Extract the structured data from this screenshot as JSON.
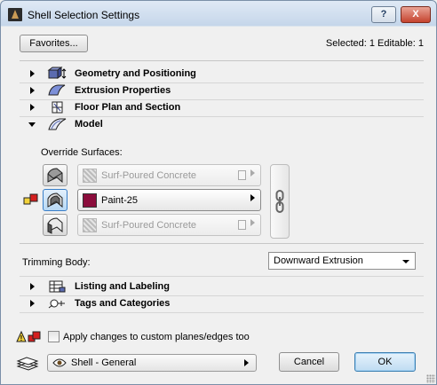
{
  "window": {
    "title": "Shell Selection Settings",
    "help_label": "?",
    "close_label": "X"
  },
  "toolbar": {
    "favorites_label": "Favorites...",
    "selection_info": "Selected: 1 Editable: 1"
  },
  "sections": [
    {
      "label": "Geometry and Positioning",
      "expanded": false,
      "icon": "geometry-icon"
    },
    {
      "label": "Extrusion Properties",
      "expanded": false,
      "icon": "extrusion-icon"
    },
    {
      "label": "Floor Plan and Section",
      "expanded": false,
      "icon": "floor-plan-icon"
    },
    {
      "label": "Model",
      "expanded": true,
      "icon": "model-icon"
    },
    {
      "label": "Listing and Labeling",
      "expanded": false,
      "icon": "listing-icon"
    },
    {
      "label": "Tags and Categories",
      "expanded": false,
      "icon": "tags-icon"
    }
  ],
  "model": {
    "override_label": "Override Surfaces:",
    "surfaces": [
      {
        "name": "Surf-Poured Concrete",
        "active": false,
        "icon": "outer-surface-icon"
      },
      {
        "name": "Paint-25",
        "active": true,
        "icon": "inner-surface-icon",
        "color": "#8b0d3c"
      },
      {
        "name": "Surf-Poured Concrete",
        "active": false,
        "icon": "edge-surface-icon"
      }
    ],
    "trimming_label": "Trimming Body:",
    "trimming_value": "Downward Extrusion"
  },
  "footer": {
    "apply_label": "Apply changes to custom planes/edges too",
    "apply_checked": false,
    "view_value": "Shell - General",
    "cancel_label": "Cancel",
    "ok_label": "OK"
  }
}
